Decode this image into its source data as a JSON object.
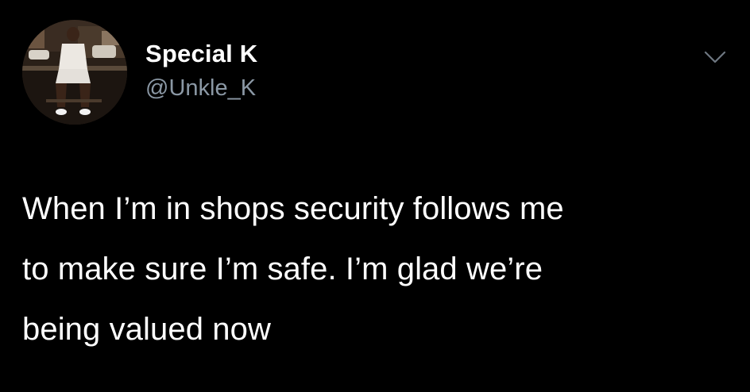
{
  "colors": {
    "background": "#000000",
    "primary_text": "#ffffff",
    "secondary_text": "#8b98a5",
    "caret": "#6e7781"
  },
  "author": {
    "display_name": "Special K",
    "handle": "@Unkle_K",
    "avatar_icon": "profile-photo"
  },
  "menu": {
    "icon": "chevron-down-icon"
  },
  "tweet": {
    "lines": [
      "When I’m in shops security follows me",
      "to make sure I’m safe. I’m glad we’re",
      "being valued now"
    ]
  }
}
